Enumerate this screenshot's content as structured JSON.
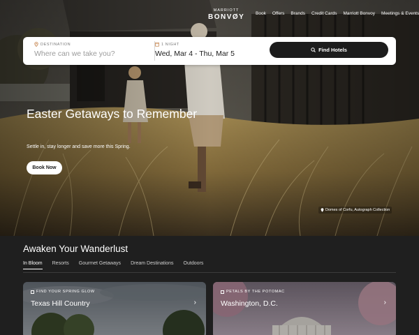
{
  "brand": {
    "line1": "MARRIOTT",
    "line2": "BONVØY"
  },
  "nav": {
    "items": [
      "Book",
      "Offers",
      "Brands",
      "Credit Cards",
      "Marriott Bonvoy",
      "Meetings & Events"
    ]
  },
  "search": {
    "destination_label": "DESTINATION",
    "destination_placeholder": "Where can we take you?",
    "nights_label": "1 NIGHT",
    "dates_value": "Wed, Mar 4 - Thu, Mar 5",
    "button_label": "Find Hotels"
  },
  "hero": {
    "title": "Easter Getaways to Remember",
    "subtitle": "Settle in, stay longer and save more this Spring.",
    "cta_label": "Book Now",
    "photo_credit": "Domes of Corfu, Autograph Collection"
  },
  "section": {
    "title": "Awaken Your Wanderlust",
    "tabs": [
      "In Bloom",
      "Resorts",
      "Gourmet Getaways",
      "Dream Destinations",
      "Outdoors"
    ],
    "active_tab": "In Bloom"
  },
  "cards": [
    {
      "kicker": "FIND YOUR SPRING GLOW",
      "title": "Texas Hill Country"
    },
    {
      "kicker": "PETALS BY THE POTOMAC",
      "title": "Washington, D.C."
    }
  ],
  "icons": {
    "search_icon": "search-icon",
    "location_icon": "location-pin-icon",
    "calendar_icon": "calendar-icon",
    "chevron_icon": "chevron-right-icon"
  },
  "colors": {
    "button_dark": "#1c1c1c",
    "section_bg": "#1f1f1f",
    "card_overlay": "#000000"
  }
}
